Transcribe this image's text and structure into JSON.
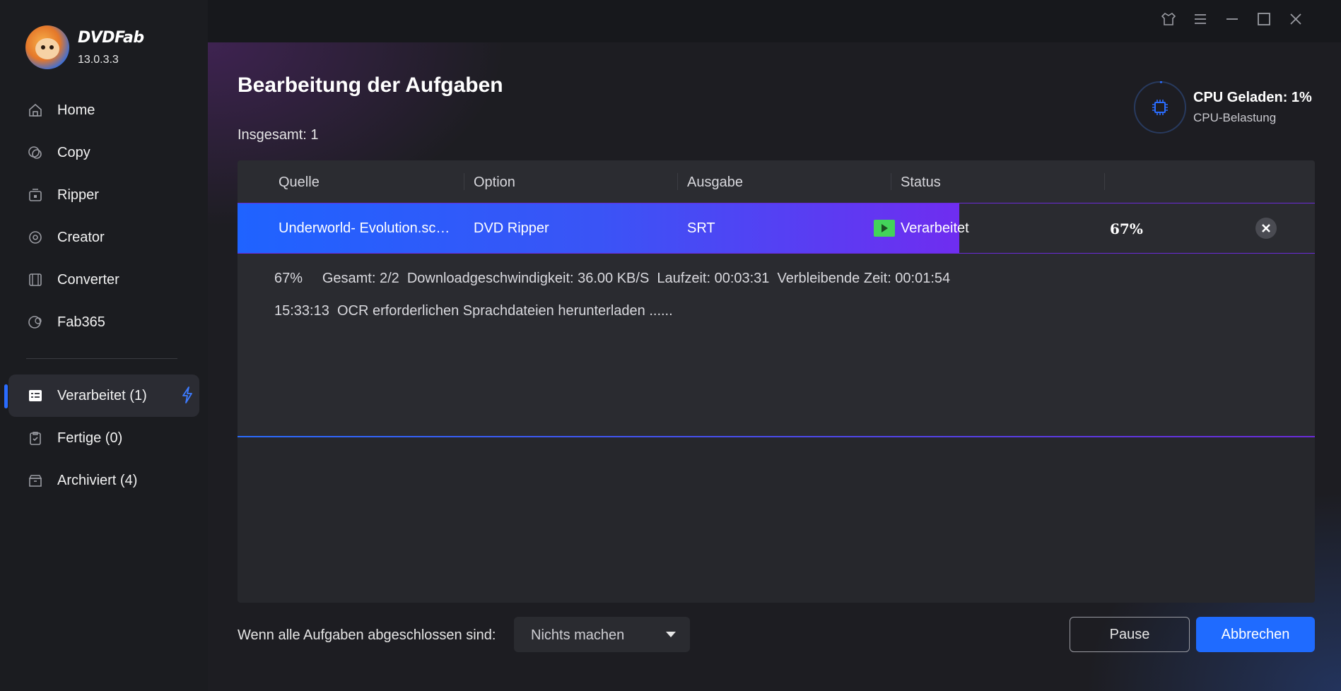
{
  "app": {
    "brand": "DVDFab",
    "version": "13.0.3.3"
  },
  "sidebar": {
    "items": [
      {
        "label": "Home",
        "icon": "home-icon"
      },
      {
        "label": "Copy",
        "icon": "copy-icon"
      },
      {
        "label": "Ripper",
        "icon": "ripper-icon"
      },
      {
        "label": "Creator",
        "icon": "creator-icon"
      },
      {
        "label": "Converter",
        "icon": "converter-icon"
      },
      {
        "label": "Fab365",
        "icon": "fab365-icon"
      }
    ],
    "queue": [
      {
        "label": "Verarbeitet (1)",
        "icon": "processing-list-icon",
        "active": true
      },
      {
        "label": "Fertige (0)",
        "icon": "finished-icon"
      },
      {
        "label": "Archiviert (4)",
        "icon": "archive-icon"
      }
    ]
  },
  "main": {
    "title": "Bearbeitung der Aufgaben",
    "total": "Insgesamt: 1"
  },
  "cpu": {
    "title": "CPU Geladen: 1%",
    "subtitle": "CPU-Belastung",
    "load_fraction": 0.01
  },
  "table": {
    "headers": [
      "Quelle",
      "Option",
      "Ausgabe",
      "Status"
    ],
    "row": {
      "source": "Underworld- Evolution.sc…",
      "option": "DVD Ripper",
      "output": "SRT",
      "status": "Verarbeitet",
      "percent": "67%",
      "progress_fraction": 0.67
    },
    "details": {
      "summary": "67%     Gesamt: 2/2  Downloadgeschwindigkeit: 36.00 KB/S  Laufzeit: 00:03:31  Verbleibende Zeit: 00:01:54",
      "log": "15:33:13  OCR erforderlichen Sprachdateien herunterladen ......"
    }
  },
  "footer": {
    "label": "Wenn alle Aufgaben abgeschlossen sind:",
    "select_value": "Nichts machen",
    "pause_label": "Pause",
    "abort_label": "Abbrechen"
  },
  "colors": {
    "accent": "#1f6bff",
    "progress_start": "#1f63ff",
    "progress_end": "#6f2df0",
    "play": "#43d35a"
  }
}
